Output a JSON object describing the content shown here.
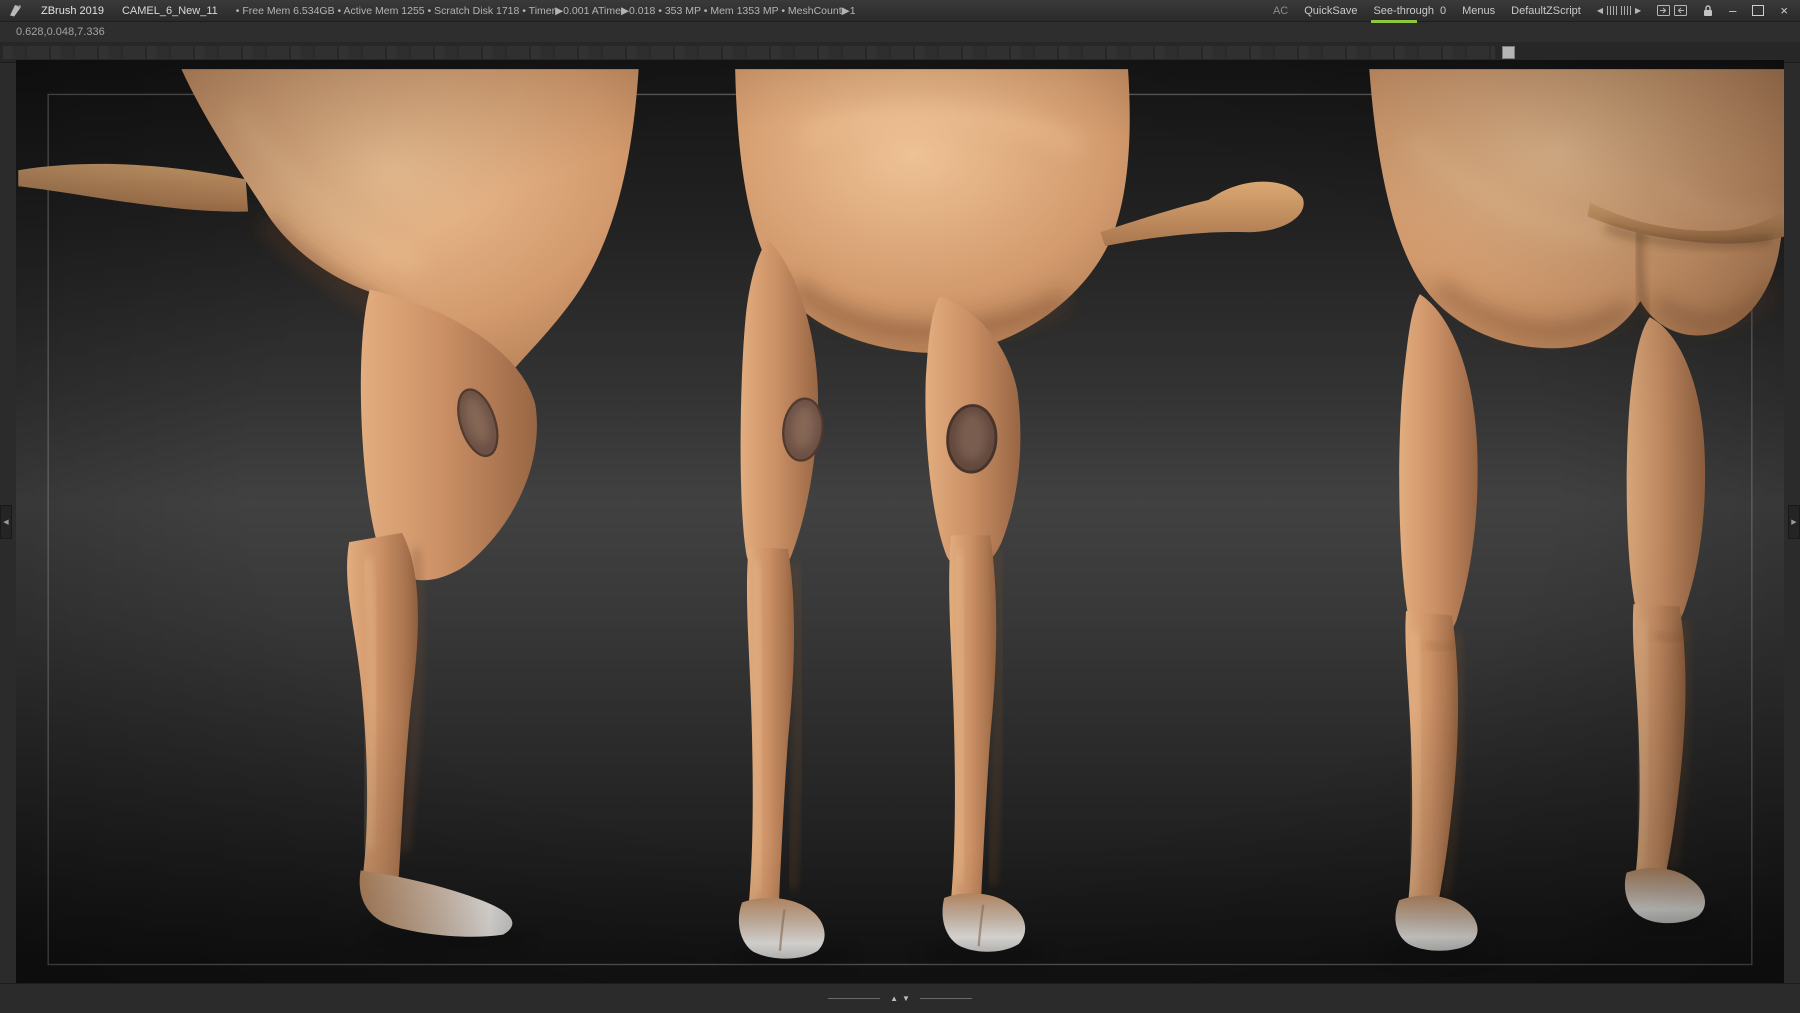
{
  "titlebar": {
    "app_title": "ZBrush 2019",
    "document_name": "CAMEL_6_New_11",
    "stats": "• Free Mem 6.534GB • Active Mem 1255 • Scratch Disk 1718 • Timer▶0.001 ATime▶0.018 • 353 MP • Mem 1353 MP • MeshCount▶1",
    "ac": "AC",
    "quicksave": "QuickSave",
    "see_through_label": "See-through",
    "see_through_value": "0",
    "menus": "Menus",
    "zscript": "DefaultZScript",
    "scroll_left_glyph": "◀",
    "scroll_right_glyph": "▶",
    "minimize_glyph": "–",
    "close_glyph": "×"
  },
  "infobar": {
    "coordinates": "0.628,0.048,7.336"
  },
  "viewport": {
    "colors": {
      "skin": "#cc9166",
      "skin_highlight": "#eec295",
      "skin_shadow": "#986644",
      "knee_pad": "#6d5145",
      "hoof": "#e9e7e3",
      "canvas_mid": "#414141",
      "frame_line": "#8f8f8f",
      "accent_green": "#8fc640"
    }
  },
  "bottombar": {
    "up_glyph": "▲",
    "down_glyph": "▼"
  },
  "edges": {
    "left_glyph": "◀",
    "right_glyph": "▶"
  }
}
